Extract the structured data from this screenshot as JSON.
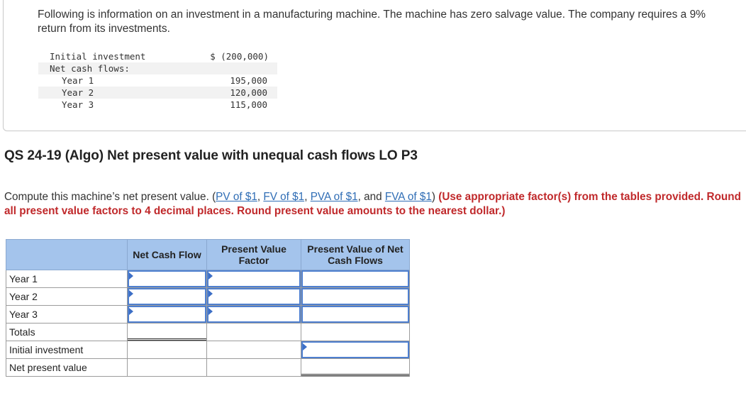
{
  "problem": {
    "intro": "Following is information on an investment in a manufacturing machine. The machine has zero salvage value. The company requires a 9% return from its investments.",
    "data_rows": [
      {
        "label": "Initial investment",
        "value": "$ (200,000)"
      },
      {
        "label": "Net cash flows:",
        "value": ""
      },
      {
        "label": "Year 1",
        "value": "195,000"
      },
      {
        "label": "Year 2",
        "value": "120,000"
      },
      {
        "label": "Year 3",
        "value": "115,000"
      }
    ]
  },
  "question": {
    "title": "QS 24-19 (Algo) Net present value with unequal cash flows LO P3",
    "instruction_prefix": "Compute this machine’s net present value. (",
    "links": [
      "PV of $1",
      "FV of $1",
      "PVA of $1",
      "FVA of $1"
    ],
    "sep1": ", ",
    "sep2": ", ",
    "sep3": ", and ",
    "instruction_suffix": ") ",
    "instruction_bold": "(Use appropriate factor(s) from the tables provided. Round all present value factors to 4 decimal places. Round present value amounts to the nearest dollar.)"
  },
  "table": {
    "headers": [
      "",
      "Net Cash Flow",
      "Present Value Factor",
      "Present Value of Net Cash Flows"
    ],
    "rows": [
      "Year 1",
      "Year 2",
      "Year 3",
      "Totals",
      "Initial investment",
      "Net present value"
    ]
  },
  "colors": {
    "header_bg": "#a4c4ec",
    "input_border": "#4e7fcf",
    "link": "#2f6db5",
    "emphasis_red": "#c0292b"
  }
}
